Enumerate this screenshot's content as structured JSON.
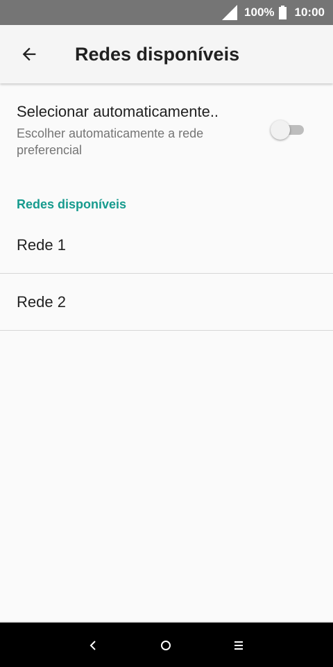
{
  "status_bar": {
    "battery_percent": "100%",
    "time": "10:00",
    "icons": [
      "signal-icon",
      "battery-icon"
    ]
  },
  "app_bar": {
    "title": "Redes disponíveis",
    "back_icon": "arrow-left-icon"
  },
  "auto_select": {
    "title": "Selecionar automaticamente..",
    "subtitle": "Escolher automaticamente a rede preferencial",
    "enabled": false
  },
  "section": {
    "title": "Redes disponíveis"
  },
  "networks": [
    {
      "label": "Rede 1"
    },
    {
      "label": "Rede 2"
    }
  ],
  "nav_bar": {
    "icons": [
      "nav-back-icon",
      "nav-home-icon",
      "nav-recents-icon"
    ]
  },
  "colors": {
    "accent": "#169b8e",
    "status_bar": "#757575",
    "app_bar": "#f5f5f5",
    "background": "#fafafa"
  }
}
